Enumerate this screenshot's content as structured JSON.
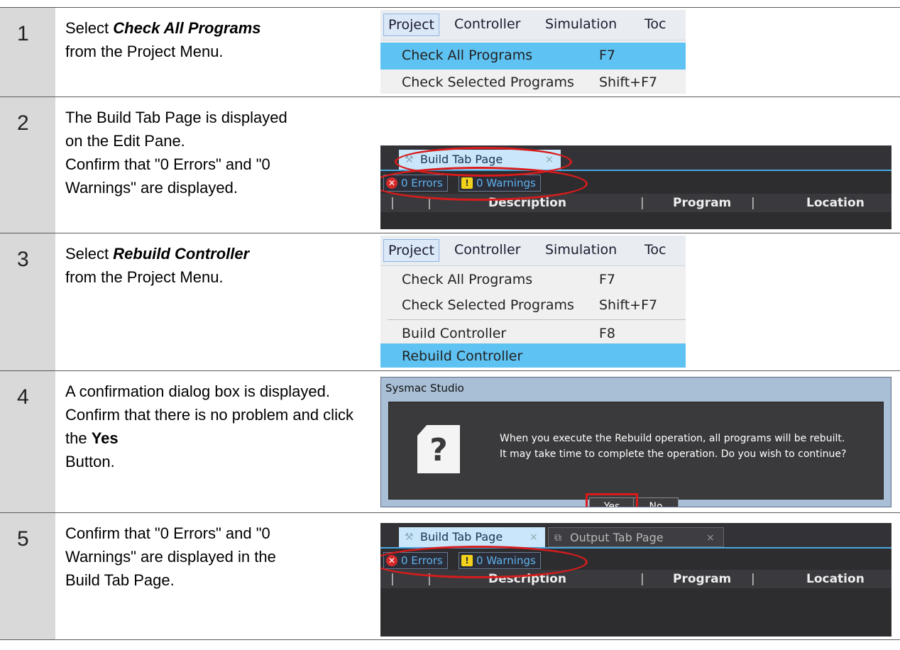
{
  "steps": [
    {
      "number": "1",
      "text": {
        "pre": "Select ",
        "bold": "Check All Programs",
        "post": " from the Project Menu."
      },
      "menu": {
        "bar": [
          "Project",
          "Controller",
          "Simulation",
          "Toc"
        ],
        "items": [
          {
            "label": "Check All Programs",
            "key": "F7",
            "highlight": true
          },
          {
            "label": "Check Selected Programs",
            "key": "Shift+F7",
            "highlight": false
          }
        ]
      }
    },
    {
      "number": "2",
      "text": {
        "lines": [
          "The Build Tab Page is displayed",
          "on the Edit Pane.",
          "Confirm that \"0 Errors\" and \"0",
          "Warnings\" are displayed."
        ]
      },
      "panel": {
        "tab": "Build Tab Page",
        "tab_close": "×",
        "errors": "0  Errors",
        "warnings": "0  Warnings",
        "columns": [
          "Description",
          "Program",
          "Location"
        ]
      }
    },
    {
      "number": "3",
      "text": {
        "pre": "Select ",
        "bold": "Rebuild Controller",
        "post": " from the Project Menu."
      },
      "menu": {
        "bar": [
          "Project",
          "Controller",
          "Simulation",
          "Toc"
        ],
        "items": [
          {
            "label": "Check All Programs",
            "key": "F7",
            "highlight": false
          },
          {
            "label": "Check Selected Programs",
            "key": "Shift+F7",
            "highlight": false
          },
          {
            "label": "Build Controller",
            "key": "F8",
            "highlight": false
          },
          {
            "label": "Rebuild Controller",
            "key": "",
            "highlight": true
          }
        ]
      }
    },
    {
      "number": "4",
      "text": {
        "pre": "A confirmation dialog box is displayed. Confirm that there is no problem and click the ",
        "bold": "Yes",
        "post": " Button."
      },
      "dialog": {
        "title": "Sysmac Studio",
        "icon": "?",
        "message": [
          "When you execute the Rebuild operation, all programs will be rebuilt.",
          "It may take time to complete the operation. Do you wish to continue?"
        ],
        "yes": "Yes",
        "no": "No"
      }
    },
    {
      "number": "5",
      "text": {
        "lines": [
          "Confirm that \"0 Errors\" and \"0",
          "Warnings\" are displayed in the",
          "Build Tab Page."
        ]
      },
      "panel": {
        "tab": "Build Tab Page",
        "tab_close": "×",
        "tab2": "Output Tab Page",
        "tab2_close": "×",
        "errors": "0  Errors",
        "warnings": "0  Warnings",
        "columns": [
          "Description",
          "Program",
          "Location"
        ]
      }
    }
  ],
  "colors": {
    "highlight": "#5ec2f2",
    "annotation": "#d91b1b",
    "step_column": "#d9d9d9"
  }
}
